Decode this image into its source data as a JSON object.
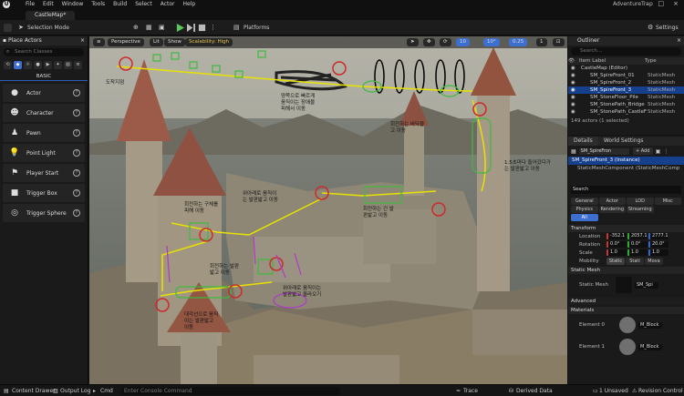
{
  "app": {
    "project_name": "AdventureTrap",
    "map_tab": "CastleMap*"
  },
  "menu": [
    "File",
    "Edit",
    "Window",
    "Tools",
    "Build",
    "Select",
    "Actor",
    "Help"
  ],
  "toolbar": {
    "selection_mode": "Selection Mode",
    "platforms": "Platforms",
    "settings": "Settings"
  },
  "place_actors": {
    "title": "Place Actors",
    "search_placeholder": "Search Classes",
    "category": "BASIC",
    "items": [
      "Actor",
      "Character",
      "Pawn",
      "Point Light",
      "Player Start",
      "Trigger Box",
      "Trigger Sphere"
    ]
  },
  "viewport": {
    "perspective": "Perspective",
    "lit": "Lit",
    "show": "Show",
    "scalability": "Scalability: High",
    "snap_translate": "10",
    "snap_rotate": "10°",
    "snap_scale": "0.25",
    "camera_speed": "1",
    "annotations": [
      "양쪽으로 빠르게\n움직이는 장애물\n피해서 이동",
      "회전하는 바닥을\n고 이동",
      "1.5초마다 들어갔다가\n는 발판밟고 이동",
      "위아래로 움직이\n는 발판밟고 이동",
      "회전하는 긴 발\n판밟고 이동",
      "회전하는 구체를\n피해 이동",
      "회전하는 발판\n밟고 이동",
      "위아래로 움직이는\n발판밟고 올라오기",
      "대각선으로 움직\n이는 발판밟고\n이동",
      "도착지점"
    ]
  },
  "outliner": {
    "title": "Outliner",
    "search_placeholder": "Search...",
    "col_label": "Item Label",
    "col_type": "Type",
    "rows": [
      {
        "name": "CastleMap (Editor)",
        "type": "",
        "sel": false
      },
      {
        "name": "SM_SpireFront_01",
        "type": "StaticMesh",
        "sel": false
      },
      {
        "name": "SM_SpireFront_2",
        "type": "StaticMesh",
        "sel": false
      },
      {
        "name": "SM_SpireFront_3",
        "type": "StaticMesh",
        "sel": true
      },
      {
        "name": "SM_StoneFloor_Pile",
        "type": "StaticMesh",
        "sel": false
      },
      {
        "name": "SM_StonePath_Bridge",
        "type": "StaticMesh",
        "sel": false
      },
      {
        "name": "SM_StonePath_CastleF",
        "type": "StaticMesh",
        "sel": false
      }
    ],
    "count": "149 actors (1 selected)"
  },
  "details": {
    "tab_details": "Details",
    "tab_world": "World Settings",
    "actor_name": "SM_SpireFron",
    "add": "+ Add",
    "instance": "SM_SpireFront_3 (Instance)",
    "component": "StaticMeshComponent (StaticMeshComp",
    "search_placeholder": "Search",
    "filter_tabs": [
      "General",
      "Actor",
      "LOD",
      "Misc",
      "Physics",
      "Rendering",
      "Streaming",
      "All"
    ],
    "transform": "Transform",
    "location": {
      "label": "Location",
      "x": "-352.1",
      "y": "2057.1",
      "z": "2777.1"
    },
    "rotation": {
      "label": "Rotation",
      "x": "0.0°",
      "y": "0.0°",
      "z": "20.0°"
    },
    "scale": {
      "label": "Scale",
      "x": "1.0",
      "y": "1.0",
      "z": "1.0"
    },
    "mobility": {
      "label": "Mobility",
      "options": [
        "Static",
        "Stati",
        "Mova"
      ]
    },
    "static_mesh_section": "Static Mesh",
    "static_mesh_label": "Static Mesh",
    "static_mesh_value": "SM_Spi",
    "advanced": "Advanced",
    "materials": "Materials",
    "element0": "Element 0",
    "element1": "Element 1",
    "mat0": "M_Block",
    "mat1": "M_Block"
  },
  "statusbar": {
    "content_drawer": "Content Drawer",
    "output_log": "Output Log",
    "cmd": "Cmd",
    "console_placeholder": "Enter Console Command",
    "trace": "Trace",
    "derived_data": "Derived Data",
    "unsaved": "1 Unsaved",
    "revision_control": "Revision Control"
  },
  "colors": {
    "accent": "#3d6fd1",
    "selected": "#163f8c",
    "play": "#5cc85c",
    "panel": "#1a1a1a"
  }
}
